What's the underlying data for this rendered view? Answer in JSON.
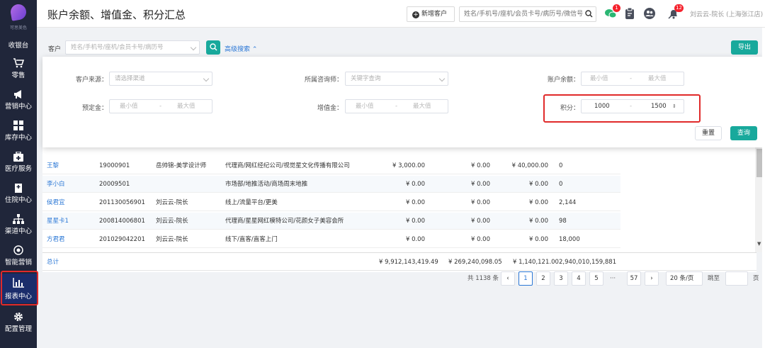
{
  "app": {
    "logo_text": "可思美色"
  },
  "sidebar": {
    "items": [
      {
        "label": "收银台"
      },
      {
        "label": "零售"
      },
      {
        "label": "营销中心"
      },
      {
        "label": "库存中心"
      },
      {
        "label": "医疗服务"
      },
      {
        "label": "住院中心"
      },
      {
        "label": "渠道中心"
      },
      {
        "label": "智能营销"
      },
      {
        "label": "报表中心"
      },
      {
        "label": "配置管理"
      }
    ]
  },
  "header": {
    "title": "账户余额、增值金、积分汇总",
    "add_customer_label": "新增客户",
    "search_placeholder": "姓名/手机号/座机/会员卡号/病历号/微信号",
    "badges": {
      "wechat": "1",
      "notice": "12"
    },
    "user": "刘云云-院长 (上海张江店)"
  },
  "toolbar": {
    "customer_label": "客户",
    "customer_placeholder": "姓名/手机号/座机/会员卡号/病历号",
    "advanced_label": "高级搜索",
    "export_label": "导出"
  },
  "advanced": {
    "source_label": "客户来源：",
    "source_placeholder": "请选择渠道",
    "consultant_label": "所属咨询师：",
    "consultant_placeholder": "关键字查询",
    "balance_label": "账户余额：",
    "deposit_label": "预定金：",
    "value_label": "增值金：",
    "points_label": "积分：",
    "min_placeholder": "最小值",
    "max_placeholder": "最大值",
    "dash": "-",
    "points_min": "1000",
    "points_max": "1500",
    "reset_label": "重置",
    "search_label": "查询"
  },
  "table": {
    "rows": [
      {
        "name": "王黎",
        "card": "19000901",
        "consultant": "岳帅锦-美学设计师",
        "source": "代理商/网红经纪公司/视觉星文化传播有限公司",
        "balance": "¥ 3,000.00",
        "deposit": "¥ 0.00",
        "value": "¥ 40,000.00",
        "points": "0"
      },
      {
        "name": "李小白",
        "card": "20009501",
        "consultant": "",
        "source": "市场部/地推活动/商场周末地推",
        "balance": "¥ 0.00",
        "deposit": "¥ 0.00",
        "value": "¥ 0.00",
        "points": "0"
      },
      {
        "name": "侯君宜",
        "card": "201130056901",
        "consultant": "刘云云-院长",
        "source": "线上/流量平台/更美",
        "balance": "¥ 0.00",
        "deposit": "¥ 0.00",
        "value": "¥ 0.00",
        "points": "2,144"
      },
      {
        "name": "星星卡1",
        "card": "200814006801",
        "consultant": "刘云云-院长",
        "source": "代理商/星星网红模特公司/花颜女子美容会所",
        "balance": "¥ 0.00",
        "deposit": "¥ 0.00",
        "value": "¥ 0.00",
        "points": "98"
      },
      {
        "name": "方君君",
        "card": "201029042201",
        "consultant": "刘云云-院长",
        "source": "线下/直客/直客上门",
        "balance": "¥ 0.00",
        "deposit": "¥ 0.00",
        "value": "¥ 0.00",
        "points": "18,000"
      }
    ],
    "total": {
      "label": "总计",
      "balance": "¥ 9,912,143,419.49",
      "deposit": "¥ 269,240,098.05",
      "value": "¥ 1,140,121.00",
      "points": "2,940,010,159,881"
    }
  },
  "pagination": {
    "total_text": "共 1138 条",
    "pages": [
      "1",
      "2",
      "3",
      "4",
      "5"
    ],
    "ellipsis": "···",
    "last_page": "57",
    "page_size": "20 条/页",
    "jump_label": "跳至",
    "page_suffix": "页"
  },
  "colors": {
    "accent": "#18a99c",
    "link": "#2c78d6",
    "sidebar": "#20263a",
    "highlight": "#e02a2a"
  }
}
